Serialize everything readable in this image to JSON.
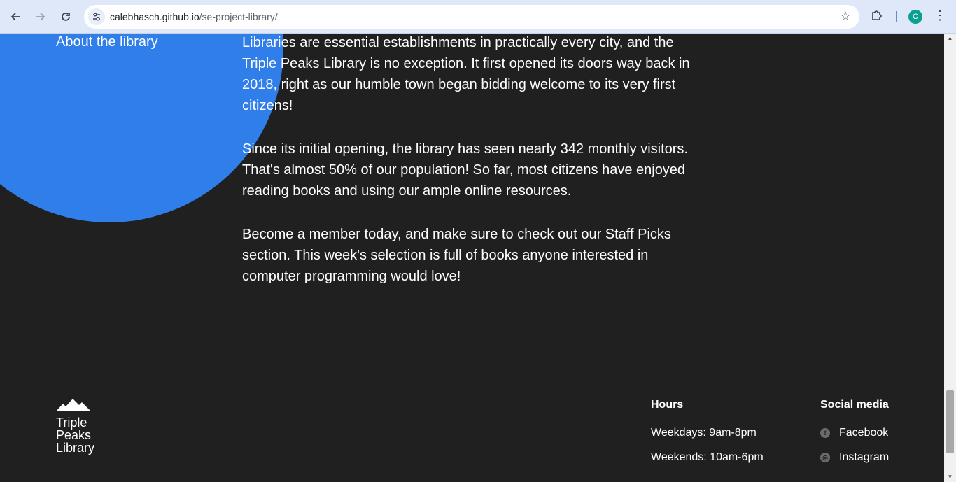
{
  "browser": {
    "url_host": "calebhasch.github.io",
    "url_path": "/se-project-library/",
    "avatar_letter": "C",
    "icons": {
      "back": "arrow-left-icon",
      "forward": "arrow-right-icon",
      "reload": "reload-icon",
      "site_info": "tune-icon",
      "bookmark": "star-icon",
      "extensions": "puzzle-icon",
      "menu": "kebab-icon"
    }
  },
  "about": {
    "title": "About the library",
    "paragraphs": [
      "Libraries are essential establishments in practically every city, and the Triple Peaks Library is no exception. It first opened its doors way back in 2018, right as our humble town began bidding welcome to its very first citizens!",
      "Since its initial opening, the library has seen nearly 342 monthly visitors. That's almost 50% of our population! So far, most citizens have enjoyed reading books and using our ample online resources.",
      "Become a member today, and make sure to check out our Staff Picks section. This week's selection is full of books anyone interested in computer programming would love!"
    ],
    "accent_color": "#2f7ee9"
  },
  "footer": {
    "logo_lines": [
      "Triple",
      "Peaks",
      "Library"
    ],
    "hours": {
      "title": "Hours",
      "weekdays": "Weekdays: 9am-8pm",
      "weekends": "Weekends: 10am-6pm"
    },
    "social": {
      "title": "Social media",
      "links": [
        {
          "label": "Facebook",
          "icon": "facebook-icon"
        },
        {
          "label": "Instagram",
          "icon": "instagram-icon"
        }
      ]
    }
  }
}
